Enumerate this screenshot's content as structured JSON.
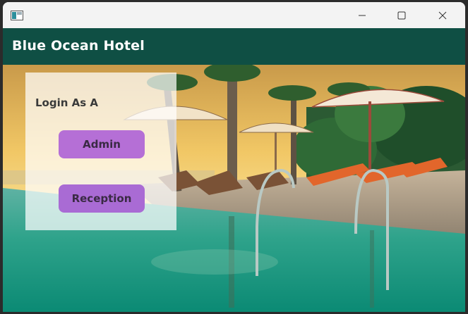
{
  "window": {
    "controls": {
      "minimize_icon": "minimize-icon",
      "maximize_icon": "maximize-icon",
      "close_icon": "close-icon"
    }
  },
  "header": {
    "title": "Blue Ocean Hotel",
    "background": "#0f4f44"
  },
  "login": {
    "prompt": "Login As A",
    "buttons": [
      {
        "label": "Admin"
      },
      {
        "label": "Reception"
      }
    ],
    "button_color": "#b56fd6"
  }
}
